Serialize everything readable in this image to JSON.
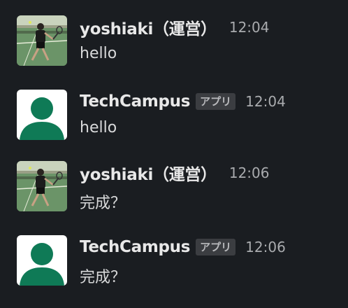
{
  "messages": [
    {
      "sender": "yoshiaki（運営）",
      "badge": "",
      "time": "12:04",
      "text": "hello",
      "avatar": "tennis-player-photo"
    },
    {
      "sender": "TechCampus",
      "badge": "アプリ",
      "time": "12:04",
      "text": "hello",
      "avatar": "default-user-avatar"
    },
    {
      "sender": "yoshiaki（運営）",
      "badge": "",
      "time": "12:06",
      "text": "完成？",
      "avatar": "tennis-player-photo"
    },
    {
      "sender": "TechCampus",
      "badge": "アプリ",
      "time": "12:06",
      "text": "完成？",
      "avatar": "default-user-avatar"
    }
  ],
  "colors": {
    "background": "#1a1d21",
    "default_avatar_bg": "#ffffff",
    "default_avatar_figure": "#0f7a56",
    "court_green": "#5f8a63"
  }
}
